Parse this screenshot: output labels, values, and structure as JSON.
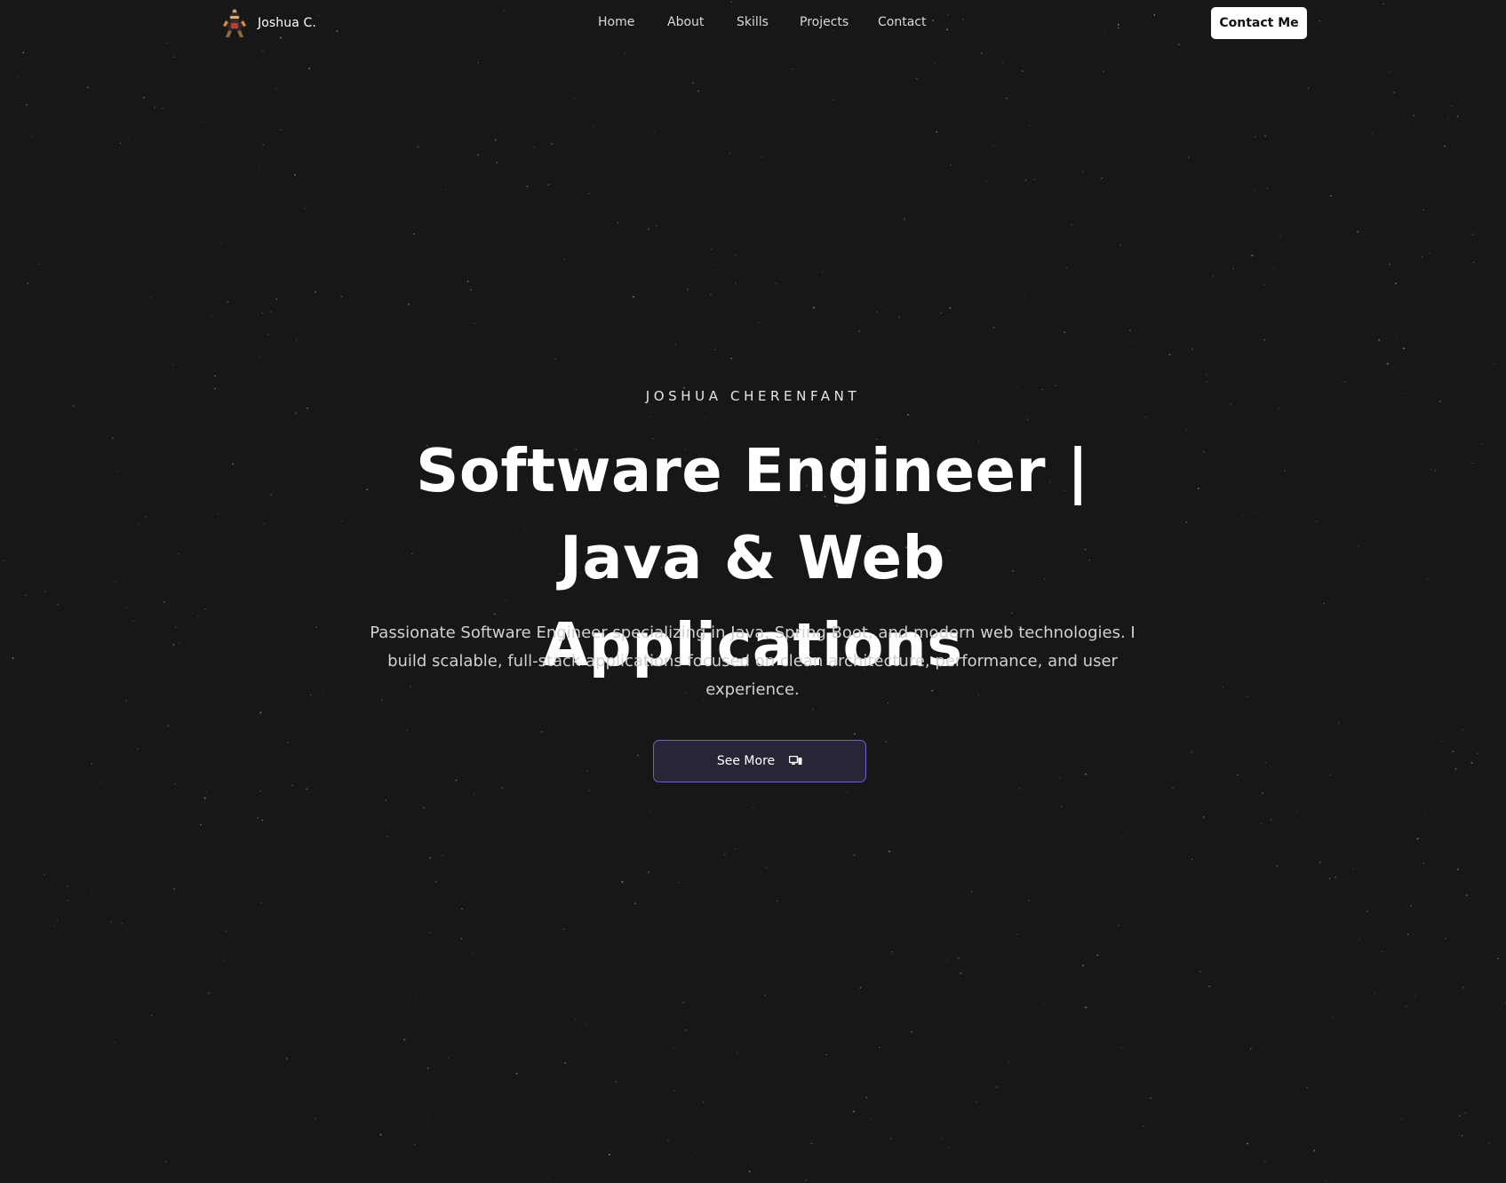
{
  "nav": {
    "brand": {
      "name": "Joshua C.",
      "logo": "ninja-avatar-icon"
    },
    "links": [
      {
        "label": "Home"
      },
      {
        "label": "About"
      },
      {
        "label": "Skills"
      },
      {
        "label": "Projects"
      },
      {
        "label": "Contact"
      }
    ],
    "cta_label": "Contact Me"
  },
  "hero": {
    "eyebrow": "JOSHUA CHERENFANT",
    "headline": "Software Engineer | Java & Web Applications",
    "subtitle": "Passionate Software Engineer specializing in Java, Spring Boot, and modern web technologies. I build scalable, full-stack applications focused on clean architecture, performance, and user experience.",
    "button_label": "See More",
    "button_icon": "devices-icon"
  },
  "colors": {
    "background": "#171718",
    "cta_background": "#ffffff",
    "button_background": "#272536",
    "button_border": "#6c62c9",
    "star": "#8a8a90"
  }
}
